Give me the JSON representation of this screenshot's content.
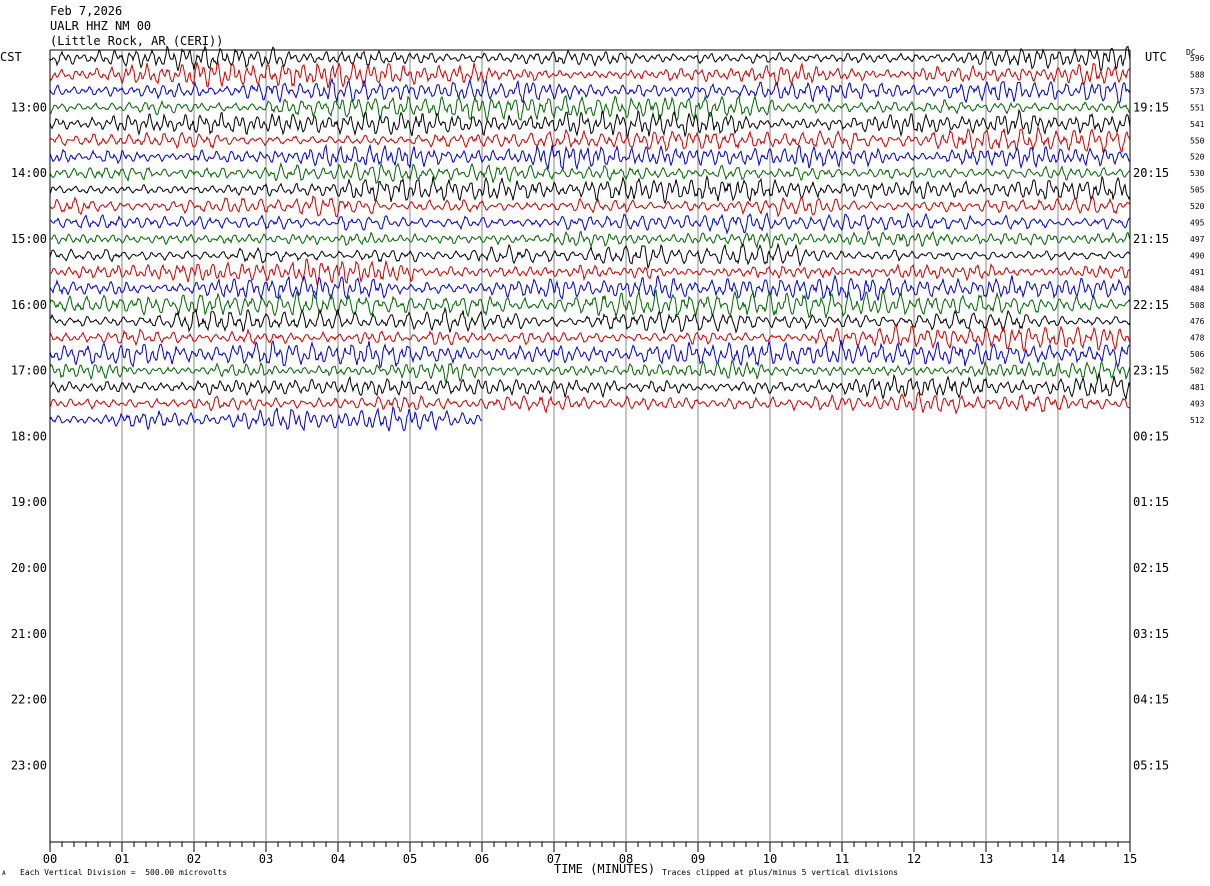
{
  "header": {
    "date": "Feb 7,2026",
    "station": "UALR HHZ NM 00",
    "location": "(Little Rock, AR (CERI))"
  },
  "left_tz": "CST",
  "right_tz": "UTC",
  "dc_label": "DC",
  "footer": {
    "scale_note": "Each Vertical Division =  500.00 microvolts",
    "clip_note": "Traces clipped at plus/minus 5 vertical divisions",
    "corner_mark": "A"
  },
  "colors": {
    "trace_cycle": [
      "#000000",
      "#cc0000",
      "#0000cc",
      "#006600"
    ],
    "grid": "#888888"
  },
  "chart_data": {
    "type": "line",
    "title": "",
    "xlabel": "TIME (MINUTES)",
    "ylabel": "",
    "xlim": [
      0,
      15
    ],
    "x_ticks": [
      "00",
      "01",
      "02",
      "03",
      "04",
      "05",
      "06",
      "07",
      "08",
      "09",
      "10",
      "11",
      "12",
      "13",
      "14",
      "15"
    ],
    "left_time_labels": [
      "13:00",
      "14:00",
      "15:00",
      "16:00",
      "17:00",
      "18:00",
      "19:00",
      "20:00",
      "21:00",
      "22:00",
      "23:00"
    ],
    "right_time_labels": [
      "19:15",
      "20:15",
      "21:15",
      "22:15",
      "23:15",
      "00:15",
      "01:15",
      "02:15",
      "03:15",
      "04:15",
      "05:15"
    ],
    "first_trace_hour_offset": 3,
    "traces_per_hour": 4,
    "trace_dc_values": [
      "596",
      "588",
      "573",
      "551",
      "541",
      "550",
      "520",
      "530",
      "505",
      "520",
      "495",
      "497",
      "490",
      "491",
      "484",
      "508",
      "476",
      "478",
      "506",
      "502",
      "481",
      "493",
      "512"
    ],
    "last_trace_end_minute": 6.0,
    "grid": true
  }
}
